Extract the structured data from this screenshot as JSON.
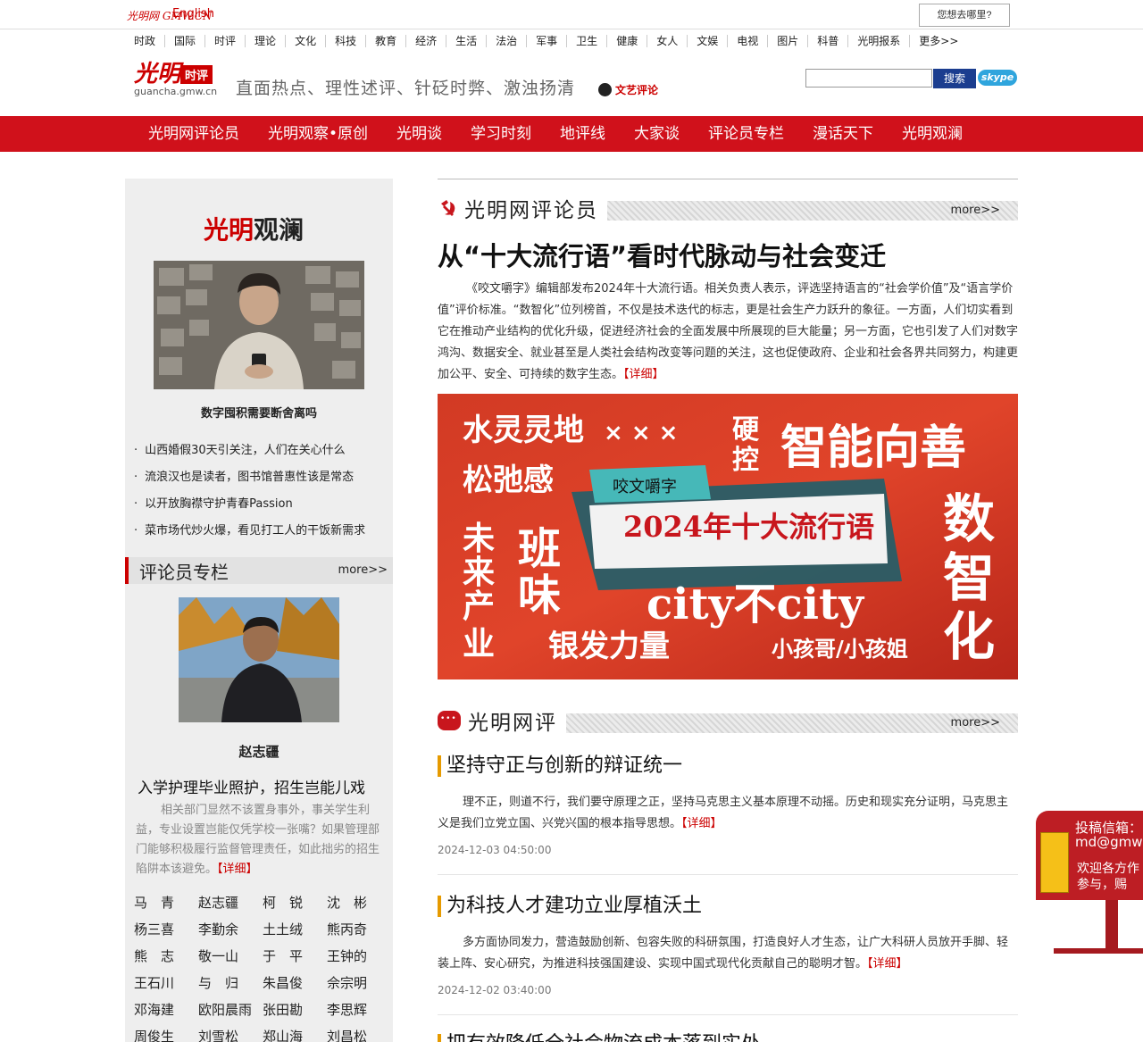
{
  "topbar": {
    "logo": "光明网 GMW.CN",
    "english": "English",
    "where_button": "您想去哪里?"
  },
  "channels": [
    "时政",
    "国际",
    "时评",
    "理论",
    "文化",
    "科技",
    "教育",
    "经济",
    "生活",
    "法治",
    "军事",
    "卫生",
    "健康",
    "女人",
    "文娱",
    "电视",
    "图片",
    "科普",
    "光明报系",
    "更多>>"
  ],
  "header": {
    "brand_name": "光明",
    "brand_tag": "时评",
    "brand_url": "guancha.gmw.cn",
    "slogan": "直面热点、理性述评、针砭时弊、激浊扬清",
    "wenyi": "文艺评论",
    "search_placeholder": "",
    "search_button": "搜索",
    "skype": "skype"
  },
  "rednav": [
    "光明网评论员",
    "光明观察•原创",
    "光明谈",
    "学习时刻",
    "地评线",
    "大家谈",
    "评论员专栏",
    "漫话天下",
    "光明观澜"
  ],
  "left": {
    "guanlan_title_a": "光明",
    "guanlan_title_b": "观澜",
    "feature_caption": "数字囤积需要断舍离吗",
    "list": [
      "山西婚假30天引关注，人们在关心什么",
      "流浪汉也是读者，图书馆普惠性该是常态",
      "以开放胸襟守护青春Passion",
      "菜市场代炒火爆，看见打工人的干饭新需求"
    ],
    "column_header": "评论员专栏",
    "column_more": "more>>",
    "columnist_name": "赵志疆",
    "column_title": "入学护理毕业照护，招生岂能儿戏",
    "column_body": "相关部门显然不该置身事外，事关学生利益，专业设置岂能仅凭学校一张嘴？如果管理部门能够积极履行监督管理责任，如此拙劣的招生陷阱本该避免。",
    "detail": "【详细】",
    "names": [
      "马　青",
      "赵志疆",
      "柯　锐",
      "沈　彬",
      "杨三喜",
      "李勤余",
      "土土绒",
      "熊丙奇",
      "熊　志",
      "敬一山",
      "于　平",
      "王钟的",
      "王石川",
      "与　归",
      "朱昌俊",
      "佘宗明",
      "邓海建",
      "欧阳晨雨",
      "张田勘",
      "李思辉",
      "周俊生",
      "刘雪松",
      "郑山海",
      "刘昌松"
    ]
  },
  "right": {
    "sec1_title": "光明网评论员",
    "sec1_more": "more>>",
    "headline": "从“十大流行语”看时代脉动与社会变迁",
    "lead": "《咬文嚼字》编辑部发布2024年十大流行语。相关负责人表示，评选坚持语言的“社会学价值”及“语言学价值”评价标准。“数智化”位列榜首，不仅是技术迭代的标志，更是社会生产力跃升的象征。一方面，人们切实看到它在推动产业结构的优化升级，促进经济社会的全面发展中所展现的巨大能量；另一方面，它也引发了人们对数字鸿沟、数据安全、就业甚至是人类社会结构改变等问题的关注，这也促使政府、企业和社会各界共同努力，构建更加公平、安全、可持续的数字生态。",
    "lead_detail": "【详细】",
    "banner": {
      "w1": "水灵灵地",
      "w1x": "× × ×",
      "w2": "松弛感",
      "w3a": "硬",
      "w3b": "控",
      "w4": "智能向善",
      "badge": "咬文嚼字",
      "main": "2024年十大流行语",
      "w5": "未来产业",
      "w6a": "班",
      "w6b": "味",
      "w7": "city不city",
      "w8": "银发力量",
      "w9": "小孩哥/小孩姐",
      "w10": "数智化"
    },
    "sec2_title": "光明网评",
    "sec2_more": "more>>",
    "articles": [
      {
        "title": "坚持守正与创新的辩证统一",
        "body": "理不正，则道不行，我们要守原理之正，坚持马克思主义基本原理不动摇。历史和现实充分证明，马克思主义是我们立党立国、兴党兴国的根本指导思想。",
        "detail": "【详细】",
        "date": "2024-12-03 04:50:00"
      },
      {
        "title": "为科技人才建功立业厚植沃土",
        "body": "多方面协同发力，营造鼓励创新、包容失败的科研氛围，打造良好人才生态，让广大科研人员放开手脚、轻装上阵、安心研究，为推进科技强国建设、实现中国式现代化贡献自己的聪明才智。",
        "detail": "【详细】",
        "date": "2024-12-02 03:40:00"
      },
      {
        "title": "把有效降低全社会物流成本落到实处",
        "body": "",
        "detail": "",
        "date": ""
      }
    ]
  },
  "mailbox": {
    "line1": "投稿信箱：",
    "line2": "md@gmw",
    "line3": "欢迎各方作",
    "line4": "参与，赐"
  },
  "colors": {
    "brand_red": "#d0111b",
    "accent_orange": "#e69a00",
    "search_blue": "#1b3d8f"
  }
}
